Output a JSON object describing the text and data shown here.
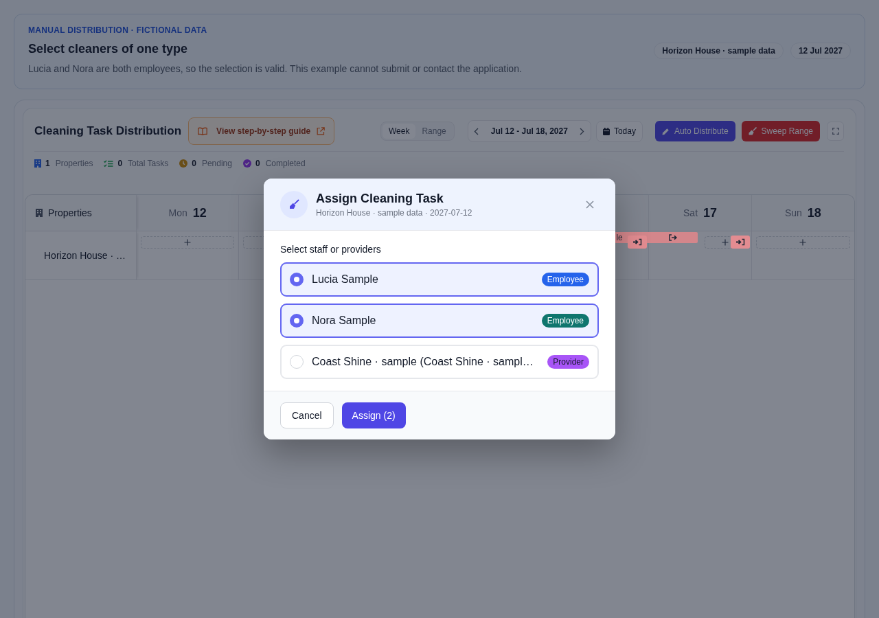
{
  "intro": {
    "eyebrow": "MANUAL DISTRIBUTION · FICTIONAL DATA",
    "title": "Select cleaners of one type",
    "description": "Lucia and Nora are both employees, so the selection is valid. This example cannot submit or contact the application.",
    "chips": [
      "Horizon House · sample data",
      "12 Jul 2027"
    ]
  },
  "toolbar": {
    "title": "Cleaning Task Distribution",
    "guide_link": "View step-by-step guide",
    "view_modes": [
      {
        "label": "Week",
        "selected": true
      },
      {
        "label": "Range",
        "selected": false
      }
    ],
    "date_range": "Jul 12 - Jul 18, 2027",
    "today": "Today",
    "actions": [
      {
        "label": "Auto Distribute",
        "kind": "auto"
      },
      {
        "label": "Sweep Range",
        "kind": "sweep"
      }
    ]
  },
  "stats": [
    {
      "kind": "properties",
      "value": "1",
      "label": "Properties"
    },
    {
      "kind": "tasks",
      "value": "0",
      "label": "Total Tasks"
    },
    {
      "kind": "pending",
      "value": "0",
      "label": "Pending"
    },
    {
      "kind": "completed",
      "value": "0",
      "label": "Completed"
    }
  ],
  "calendar": {
    "corner": "Properties",
    "days_left_of_dialog": [
      {
        "weekday": "Mon",
        "date": "12"
      }
    ],
    "days_right_of_dialog": [
      {
        "weekday": "Sat",
        "date": "17"
      },
      {
        "weekday": "Sun",
        "date": "18"
      }
    ],
    "rows": [
      {
        "property": "Horizon House · …",
        "cells_left_of_dialog": [
          {
            "items": [
              {
                "kind": "add"
              }
            ]
          },
          {
            "items": [
              {
                "kind": "add"
              }
            ]
          }
        ],
        "cells_right_of_dialog": [
          {
            "items": [
              {
                "kind": "check-in"
              }
            ]
          },
          {
            "booking": {
              "label": "le",
              "kind": "check-out"
            },
            "items": [
              {
                "kind": "add"
              },
              {
                "kind": "check-in"
              }
            ]
          },
          {
            "items": [
              {
                "kind": "add"
              }
            ]
          }
        ]
      }
    ]
  },
  "modal": {
    "title": "Assign Cleaning Task",
    "subtitle": "Horizon House · sample data · 2027-07-12",
    "prompt": "Select staff or providers",
    "options": [
      {
        "name": "Lucia Sample",
        "badge": "Employee",
        "color": "#2563eb",
        "selected": true
      },
      {
        "name": "Nora Sample",
        "badge": "Employee",
        "color": "#0f766e",
        "selected": true
      },
      {
        "name": "Coast Shine · sample (Coast Shine · sampl…",
        "badge": "Provider",
        "color": "#a855f7",
        "selected": false
      }
    ],
    "buttons": [
      {
        "label": "Cancel",
        "kind": "secondary"
      },
      {
        "label": "Assign (2)",
        "kind": "primary"
      }
    ]
  }
}
